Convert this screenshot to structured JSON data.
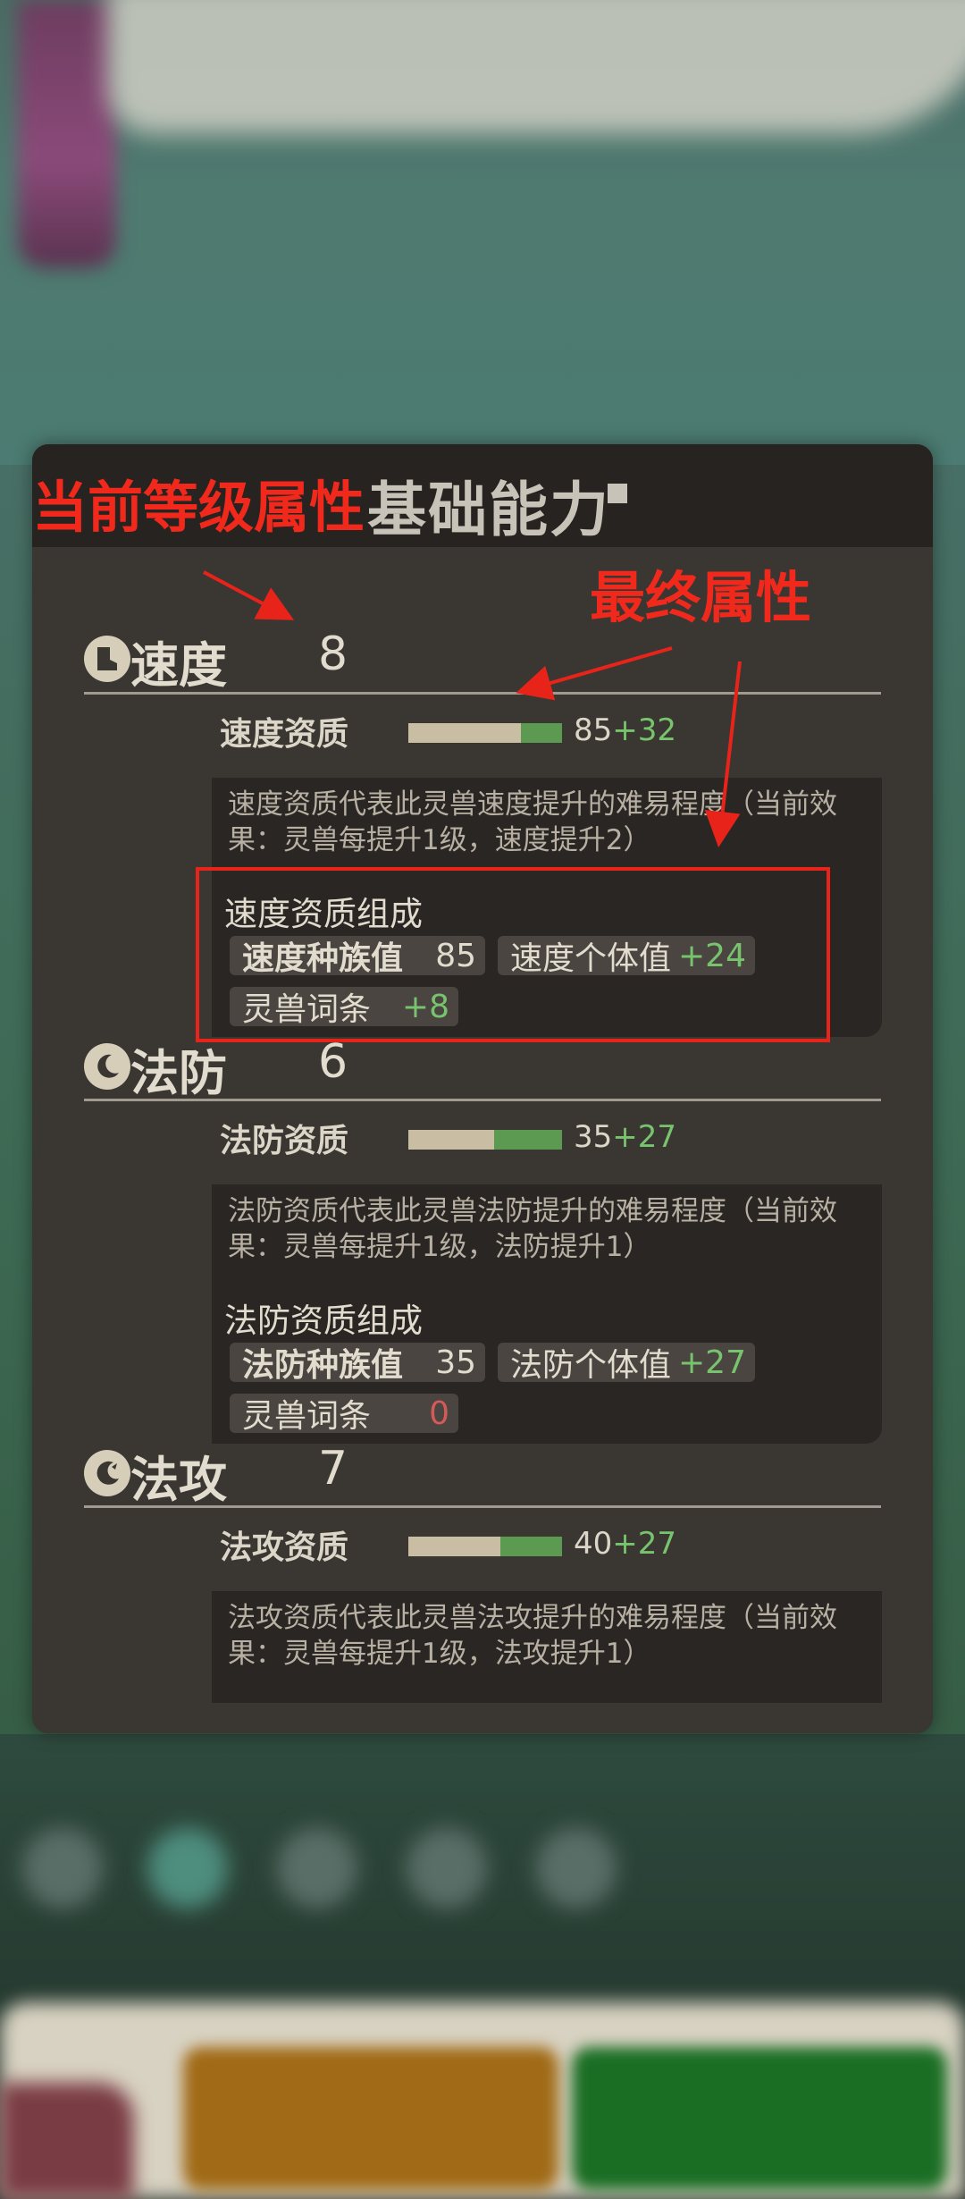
{
  "panel": {
    "title": "基础能力"
  },
  "annotations": {
    "current_level_attr": "当前等级属性",
    "final_attr": "最终属性"
  },
  "sections": [
    {
      "name": "速度",
      "icon": "boot-icon",
      "level": "8",
      "aptitude_label": "速度资质",
      "aptitude_base": "85",
      "aptitude_bonus": "+32",
      "description": "速度资质代表此灵兽速度提升的难易程度（当前效果：灵兽每提升1级，速度提升2）",
      "composition_title": "速度资质组成",
      "chips": [
        {
          "label": "速度种族值",
          "value": "85"
        },
        {
          "label": "速度个体值",
          "value": "+24"
        },
        {
          "label": "灵兽词条",
          "value": "+8"
        }
      ]
    },
    {
      "name": "法防",
      "icon": "crescent-shield-icon",
      "level": "6",
      "aptitude_label": "法防资质",
      "aptitude_base": "35",
      "aptitude_bonus": "+27",
      "description": "法防资质代表此灵兽法防提升的难易程度（当前效果：灵兽每提升1级，法防提升1）",
      "composition_title": "法防资质组成",
      "chips": [
        {
          "label": "法防种族值",
          "value": "35"
        },
        {
          "label": "法防个体值",
          "value": "+27"
        },
        {
          "label": "灵兽词条",
          "value": "0"
        }
      ]
    },
    {
      "name": "法攻",
      "icon": "magic-flame-icon",
      "level": "7",
      "aptitude_label": "法攻资质",
      "aptitude_base": "40",
      "aptitude_bonus": "+27",
      "description": "法攻资质代表此灵兽法攻提升的难易程度（当前效果：灵兽每提升1级，法攻提升1）"
    }
  ],
  "colors": {
    "annotation_red": "#f0291c",
    "bonus_green": "#78c46e",
    "zero_red": "#d45a5a",
    "panel_bg": "#3a3632"
  },
  "aptitude_bar_fill": [
    {
      "base_fraction": 0.73,
      "bonus_fraction": 0.27
    },
    {
      "base_fraction": 0.56,
      "bonus_fraction": 0.44
    },
    {
      "base_fraction": 0.6,
      "bonus_fraction": 0.4
    }
  ]
}
